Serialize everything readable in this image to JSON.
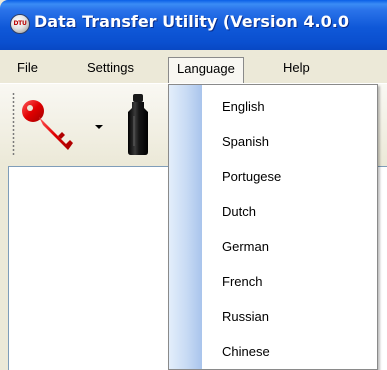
{
  "window": {
    "title": "Data Transfer Utility (Version 4.0.0",
    "icon_label": "DTU",
    "icon": "app-logo-icon"
  },
  "menubar": {
    "items": [
      {
        "label": "File"
      },
      {
        "label": "Settings"
      },
      {
        "label": "Language",
        "active": true
      },
      {
        "label": "Help"
      }
    ]
  },
  "toolbar": {
    "buttons": [
      {
        "icon": "key-icon",
        "color": "#d40000",
        "has_dropdown": true
      },
      {
        "icon": "bottle-icon",
        "color": "#111111"
      }
    ]
  },
  "language_menu": {
    "items": [
      {
        "label": "English"
      },
      {
        "label": "Spanish"
      },
      {
        "label": "Portugese"
      },
      {
        "label": "Dutch"
      },
      {
        "label": "German"
      },
      {
        "label": "French"
      },
      {
        "label": "Russian"
      },
      {
        "label": "Chinese"
      }
    ]
  },
  "colors": {
    "titlebar": "#0a4fcf",
    "menubar": "#ece9d8",
    "menu_gutter": "#c7daf4"
  }
}
